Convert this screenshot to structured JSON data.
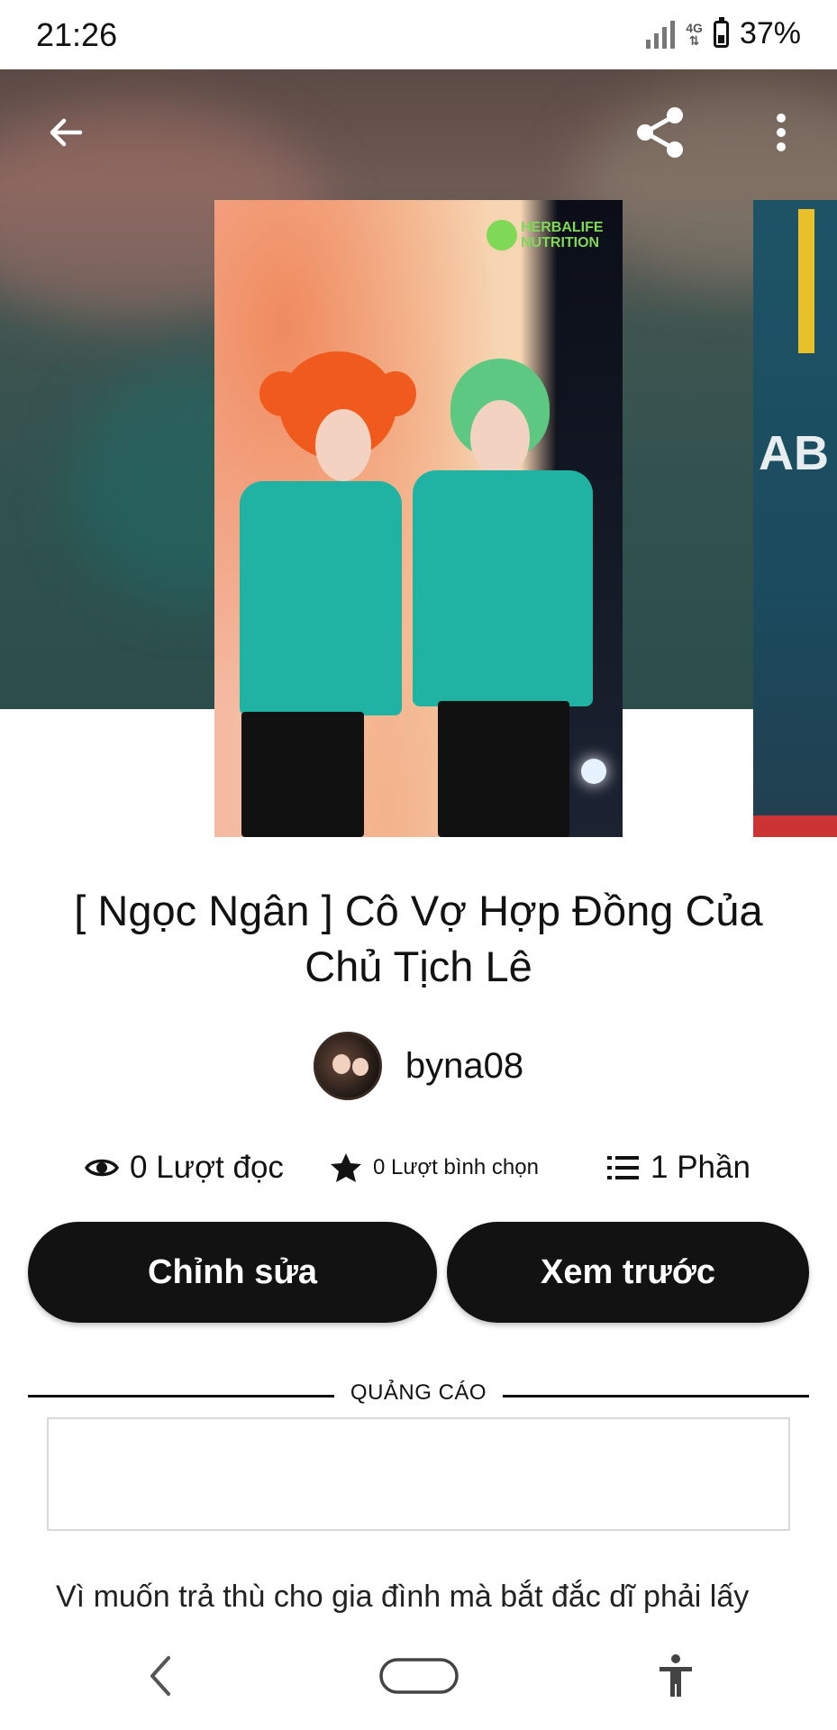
{
  "status_bar": {
    "time": "21:26",
    "network": "4G",
    "battery": "37%"
  },
  "header": {
    "back_icon": "arrow-left-icon",
    "share_icon": "share-icon",
    "menu_icon": "more-vertical-icon"
  },
  "cover": {
    "brand_line1": "HERBALIFE",
    "brand_line2": "NUTRITION",
    "side_text": "AB"
  },
  "story": {
    "title": "[ Ngọc Ngân ] Cô Vợ Hợp Đồng Của Chủ Tịch Lê",
    "author": "byna08"
  },
  "stats": {
    "reads": "0 Lượt đọc",
    "votes": "0 Lượt bình chọn",
    "parts": "1 Phần"
  },
  "actions": {
    "edit": "Chỉnh sửa",
    "preview": "Xem trước"
  },
  "ad": {
    "label": "QUẢNG CÁO"
  },
  "description": "Vì muốn trả thù cho gia đình mà bắt đắc dĩ phải lấy",
  "nav": {
    "back": "nav-back-icon",
    "home": "nav-home-icon",
    "accessibility": "accessibility-icon"
  },
  "colors": {
    "accent_dark": "#121212",
    "hero_teal": "#2f524f",
    "shirt": "#20b3a3"
  }
}
